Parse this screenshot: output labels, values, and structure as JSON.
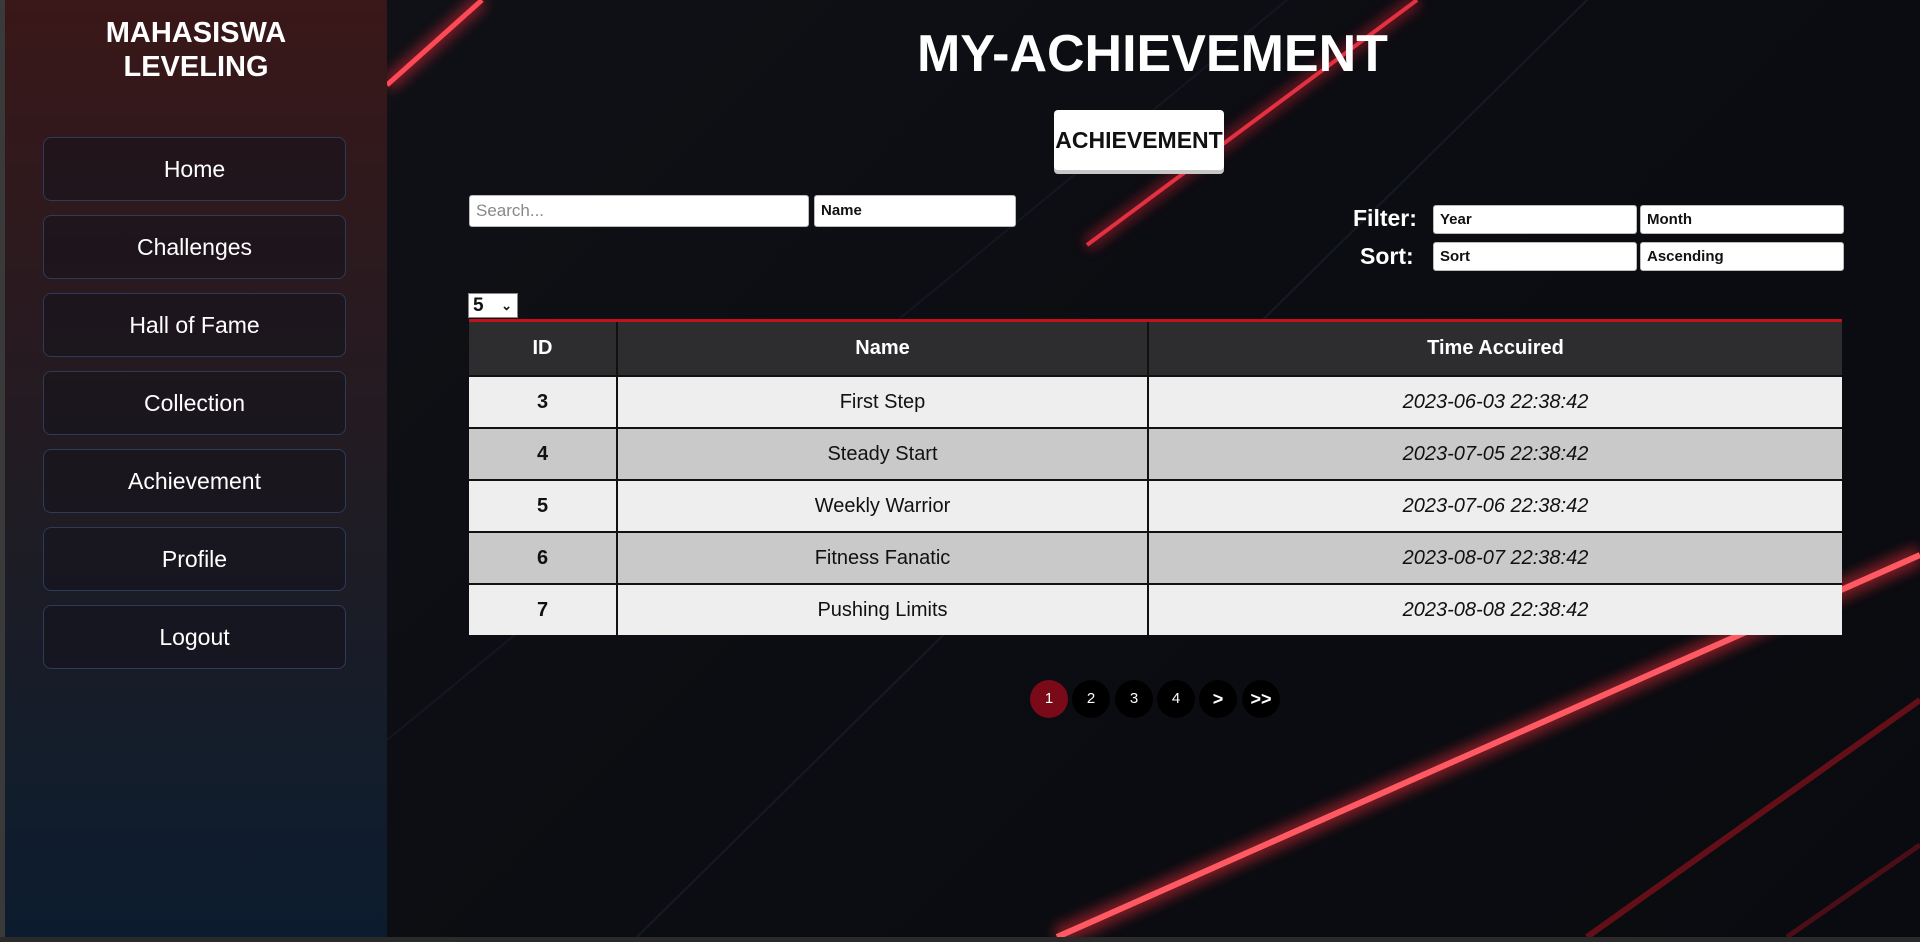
{
  "sidebar": {
    "brand_line1": "MAHASISWA",
    "brand_line2": "LEVELING",
    "items": [
      {
        "label": "Home"
      },
      {
        "label": "Challenges"
      },
      {
        "label": "Hall of Fame"
      },
      {
        "label": "Collection"
      },
      {
        "label": "Achievement"
      },
      {
        "label": "Profile"
      },
      {
        "label": "Logout"
      }
    ]
  },
  "header": {
    "title": "MY-ACHIEVEMENT",
    "tab": "ACHIEVEMENT"
  },
  "controls": {
    "search_placeholder": "Search...",
    "search_field": "Name",
    "filter_label": "Filter:",
    "sort_label": "Sort:",
    "year": "Year",
    "month": "Month",
    "sort": "Sort",
    "order": "Ascending",
    "page_size": "5"
  },
  "table": {
    "headers": [
      "ID",
      "Name",
      "Time Accuired"
    ],
    "rows": [
      [
        "3",
        "First Step",
        "2023-06-03 22:38:42"
      ],
      [
        "4",
        "Steady Start",
        "2023-07-05 22:38:42"
      ],
      [
        "5",
        "Weekly Warrior",
        "2023-07-06 22:38:42"
      ],
      [
        "6",
        "Fitness Fanatic",
        "2023-08-07 22:38:42"
      ],
      [
        "7",
        "Pushing Limits",
        "2023-08-08 22:38:42"
      ]
    ]
  },
  "pagination": {
    "pages": [
      "1",
      "2",
      "3",
      "4"
    ],
    "next": ">",
    "last": ">>",
    "current": "1"
  },
  "colors": {
    "accent_red": "#c4121c",
    "active_page": "#7a0a18",
    "sidebar_border": "#2d3b59"
  }
}
